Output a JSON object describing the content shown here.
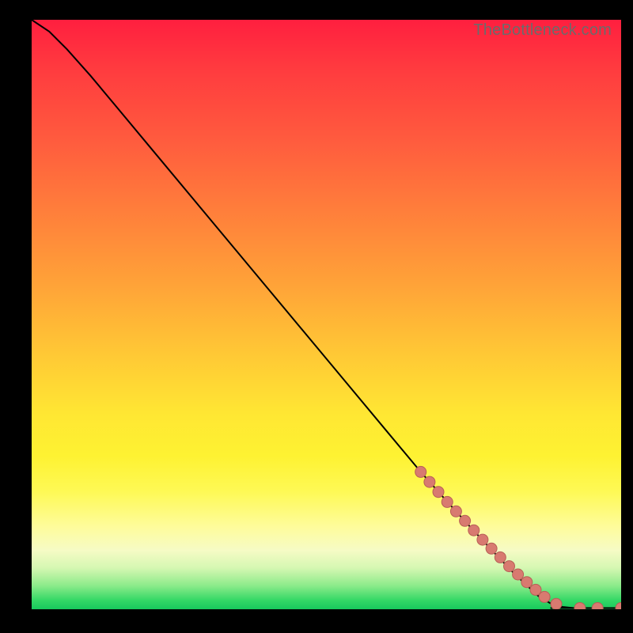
{
  "watermark": "TheBottleneck.com",
  "colors": {
    "marker_fill": "#d87a70",
    "marker_stroke": "#b85f56",
    "curve": "#000000",
    "frame_bg": "#000000"
  },
  "chart_data": {
    "type": "line",
    "title": "",
    "xlabel": "",
    "ylabel": "",
    "xlim": [
      0,
      100
    ],
    "ylim": [
      0,
      100
    ],
    "grid": false,
    "series": [
      {
        "name": "curve",
        "x": [
          0,
          3,
          6,
          10,
          15,
          20,
          30,
          40,
          50,
          60,
          66,
          70,
          74,
          78,
          82,
          86,
          88,
          90,
          92,
          94,
          96,
          98,
          100
        ],
        "y": [
          100,
          98,
          95,
          90.5,
          84.5,
          78.5,
          66.5,
          54.5,
          42.5,
          30.5,
          23.3,
          18.8,
          14.4,
          10.1,
          5.9,
          2.2,
          1.0,
          0.4,
          0.2,
          0.2,
          0.2,
          0.2,
          0.2
        ]
      }
    ],
    "markers": {
      "name": "highlighted-range",
      "x": [
        66,
        67.5,
        69,
        70.5,
        72,
        73.5,
        75,
        76.5,
        78,
        79.5,
        81,
        82.5,
        84,
        85.5,
        87,
        89,
        93,
        96,
        100
      ],
      "y": [
        23.3,
        21.6,
        19.9,
        18.2,
        16.6,
        15.0,
        13.4,
        11.8,
        10.3,
        8.8,
        7.3,
        5.9,
        4.6,
        3.3,
        2.1,
        0.9,
        0.2,
        0.2,
        0.2
      ]
    }
  }
}
